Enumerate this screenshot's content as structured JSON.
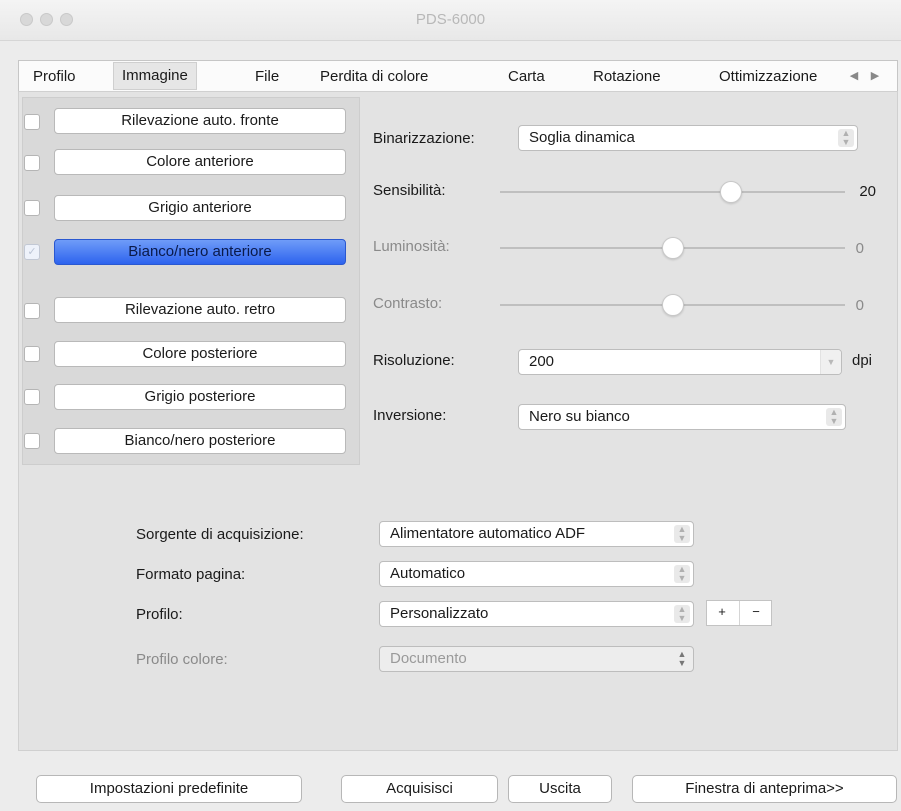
{
  "window": {
    "title": "PDS-6000"
  },
  "tabs": [
    {
      "label": "Profilo"
    },
    {
      "label": "Immagine"
    },
    {
      "label": "File"
    },
    {
      "label": "Perdita di colore"
    },
    {
      "label": "Carta"
    },
    {
      "label": "Rotazione"
    },
    {
      "label": "Ottimizzazione"
    }
  ],
  "image_types": [
    {
      "label": "Rilevazione auto. fronte",
      "checked": false
    },
    {
      "label": "Colore anteriore",
      "checked": false
    },
    {
      "label": "Grigio anteriore",
      "checked": false
    },
    {
      "label": "Bianco/nero anteriore",
      "checked": true,
      "selected": true
    },
    {
      "label": "Rilevazione auto. retro",
      "checked": false
    },
    {
      "label": "Colore posteriore",
      "checked": false
    },
    {
      "label": "Grigio posteriore",
      "checked": false
    },
    {
      "label": "Bianco/nero posteriore",
      "checked": false
    }
  ],
  "settings": {
    "binarizzazione": {
      "label": "Binarizzazione:",
      "value": "Soglia dinamica"
    },
    "sensibilita": {
      "label": "Sensibilità:",
      "value": "20",
      "fraction": 0.67,
      "enabled": true
    },
    "luminosita": {
      "label": "Luminosità:",
      "value": "0",
      "fraction": 0.5,
      "enabled": false
    },
    "contrasto": {
      "label": "Contrasto:",
      "value": "0",
      "fraction": 0.5,
      "enabled": false
    },
    "risoluzione": {
      "label": "Risoluzione:",
      "value": "200",
      "unit": "dpi"
    },
    "inversione": {
      "label": "Inversione:",
      "value": "Nero su bianco"
    }
  },
  "scan": {
    "source": {
      "label": "Sorgente di acquisizione:",
      "value": "Alimentatore automatico ADF"
    },
    "page_size": {
      "label": "Formato pagina:",
      "value": "Automatico"
    },
    "profile": {
      "label": "Profilo:",
      "value": "Personalizzato",
      "add": "+",
      "remove": "−"
    },
    "color_profile": {
      "label": "Profilo colore:",
      "value": "Documento"
    }
  },
  "footer": {
    "defaults": "Impostazioni predefinite",
    "scan": "Acquisisci",
    "exit": "Uscita",
    "preview": "Finestra di anteprima>>"
  },
  "colors": {
    "accent": "#3a6ff0",
    "background": "#ececec"
  }
}
